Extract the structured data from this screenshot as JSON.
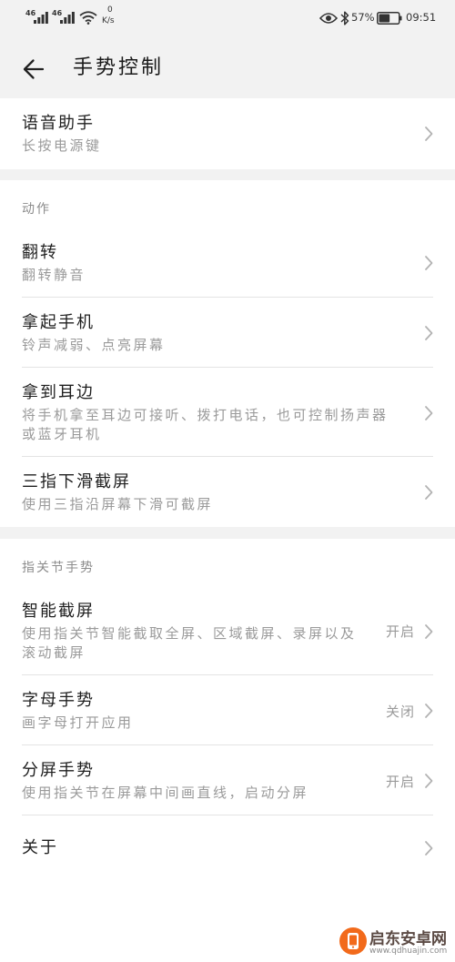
{
  "status_bar": {
    "sim1_network": "46",
    "sim2_network": "46",
    "net_speed": "0",
    "net_speed_unit": "K/s",
    "battery_percent": "57%",
    "battery_level": 0.57,
    "time": "09:51",
    "icons": [
      "signal-icon",
      "signal-icon",
      "wifi-icon",
      "eye-icon",
      "bluetooth-icon",
      "battery-icon"
    ]
  },
  "header": {
    "back_icon": "back-arrow-icon",
    "title": "手势控制"
  },
  "voice_assistant": {
    "title": "语音助手",
    "subtitle": "长按电源键"
  },
  "actions": {
    "section_title": "动作",
    "items": [
      {
        "title": "翻转",
        "subtitle": "翻转静音"
      },
      {
        "title": "拿起手机",
        "subtitle": "铃声减弱、点亮屏幕"
      },
      {
        "title": "拿到耳边",
        "subtitle": "将手机拿至耳边可接听、拨打电话，也可控制扬声器或蓝牙耳机"
      },
      {
        "title": "三指下滑截屏",
        "subtitle": "使用三指沿屏幕下滑可截屏"
      }
    ]
  },
  "knuckle_gestures": {
    "section_title": "指关节手势",
    "items": [
      {
        "title": "智能截屏",
        "subtitle": "使用指关节智能截取全屏、区域截屏、录屏以及滚动截屏",
        "status": "开启"
      },
      {
        "title": "字母手势",
        "subtitle": "画字母打开应用",
        "status": "关闭"
      },
      {
        "title": "分屏手势",
        "subtitle": "使用指关节在屏幕中间画直线，启动分屏",
        "status": "开启"
      }
    ]
  },
  "about": {
    "title": "关于"
  },
  "chevron_icon": "chevron-right-icon",
  "watermark": {
    "site_name": "启东安卓网",
    "url": "www.qdhuajin.com"
  },
  "colors": {
    "page_background": "#f2f2f2",
    "card_background": "#ffffff",
    "title_text": "#1f1f1f",
    "subtitle_text": "#9a9a9a",
    "section_title_text": "#8c8c8c",
    "chevron": "#b3b3b3",
    "divider": "#e4e4e4",
    "watermark_orange": "#f26a1b"
  }
}
